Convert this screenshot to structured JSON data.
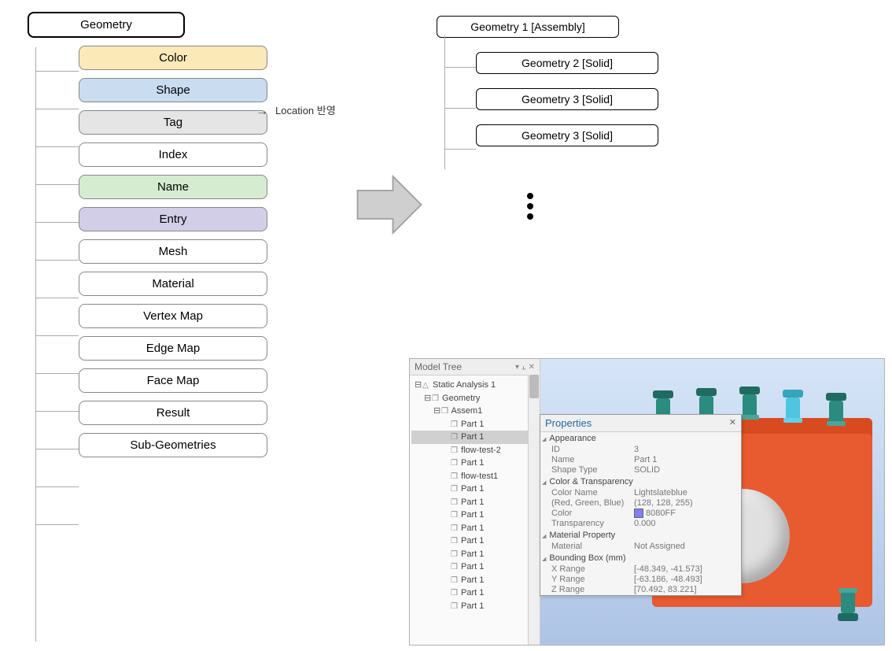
{
  "left_tree": {
    "root": "Geometry",
    "children": [
      {
        "label": "Color",
        "cls": "color-bg"
      },
      {
        "label": "Shape",
        "cls": "shape-bg"
      },
      {
        "label": "Tag",
        "cls": "tag-bg"
      },
      {
        "label": "Index",
        "cls": "white-bg"
      },
      {
        "label": "Name",
        "cls": "name-bg"
      },
      {
        "label": "Entry",
        "cls": "entry-bg"
      },
      {
        "label": "Mesh",
        "cls": "white-bg"
      },
      {
        "label": "Material",
        "cls": "white-bg"
      },
      {
        "label": "Vertex Map",
        "cls": "white-bg"
      },
      {
        "label": "Edge Map",
        "cls": "white-bg"
      },
      {
        "label": "Face Map",
        "cls": "white-bg"
      },
      {
        "label": "Result",
        "cls": "white-bg"
      },
      {
        "label": "Sub-Geometries",
        "cls": "white-bg"
      }
    ]
  },
  "location_note": "Location 반영",
  "right_tree": {
    "root": "Geometry 1 [Assembly]",
    "children": [
      "Geometry 2 [Solid]",
      "Geometry 3 [Solid]",
      "Geometry 3 [Solid]"
    ]
  },
  "app": {
    "model_tree_title": "Model Tree",
    "tree_items": [
      {
        "label": "Static Analysis 1",
        "indent": 0,
        "prefix": "⊟",
        "icon": "△"
      },
      {
        "label": "Geometry",
        "indent": 1,
        "prefix": "⊟",
        "icon": "❒"
      },
      {
        "label": "Assem1",
        "indent": 2,
        "prefix": "⊟",
        "icon": "❒"
      },
      {
        "label": "Part 1",
        "indent": 3,
        "prefix": "",
        "icon": "❒"
      },
      {
        "label": "Part 1",
        "indent": 3,
        "prefix": "",
        "icon": "❒",
        "selected": true
      },
      {
        "label": "flow-test-2",
        "indent": 3,
        "prefix": "",
        "icon": "❒"
      },
      {
        "label": "Part 1",
        "indent": 3,
        "prefix": "",
        "icon": "❒"
      },
      {
        "label": "flow-test1",
        "indent": 3,
        "prefix": "",
        "icon": "❒"
      },
      {
        "label": "Part 1",
        "indent": 3,
        "prefix": "",
        "icon": "❒"
      },
      {
        "label": "Part 1",
        "indent": 3,
        "prefix": "",
        "icon": "❒"
      },
      {
        "label": "Part 1",
        "indent": 3,
        "prefix": "",
        "icon": "❒"
      },
      {
        "label": "Part 1",
        "indent": 3,
        "prefix": "",
        "icon": "❒"
      },
      {
        "label": "Part 1",
        "indent": 3,
        "prefix": "",
        "icon": "❒"
      },
      {
        "label": "Part 1",
        "indent": 3,
        "prefix": "",
        "icon": "❒"
      },
      {
        "label": "Part 1",
        "indent": 3,
        "prefix": "",
        "icon": "❒"
      },
      {
        "label": "Part 1",
        "indent": 3,
        "prefix": "",
        "icon": "❒"
      },
      {
        "label": "Part 1",
        "indent": 3,
        "prefix": "",
        "icon": "❒"
      },
      {
        "label": "Part 1",
        "indent": 3,
        "prefix": "",
        "icon": "❒"
      }
    ],
    "properties": {
      "title": "Properties",
      "sections": [
        {
          "name": "Appearance",
          "rows": [
            {
              "label": "ID",
              "value": "3"
            },
            {
              "label": "Name",
              "value": "Part 1"
            },
            {
              "label": "Shape Type",
              "value": "SOLID"
            }
          ]
        },
        {
          "name": "Color & Transparency",
          "rows": [
            {
              "label": "Color Name",
              "value": "Lightslateblue"
            },
            {
              "label": "(Red, Green, Blue)",
              "value": "(128, 128, 255)"
            },
            {
              "label": "Color",
              "value": "8080FF",
              "swatch": true
            },
            {
              "label": "Transparency",
              "value": "0.000"
            }
          ]
        },
        {
          "name": "Material Property",
          "rows": [
            {
              "label": "Material",
              "value": "Not Assigned"
            }
          ]
        },
        {
          "name": "Bounding Box (mm)",
          "rows": [
            {
              "label": "X Range",
              "value": "[-48.349, -41.573]"
            },
            {
              "label": "Y Range",
              "value": "[-63.186, -48.493]"
            },
            {
              "label": "Z Range",
              "value": "[70.492, 83.221]"
            }
          ]
        }
      ]
    }
  }
}
